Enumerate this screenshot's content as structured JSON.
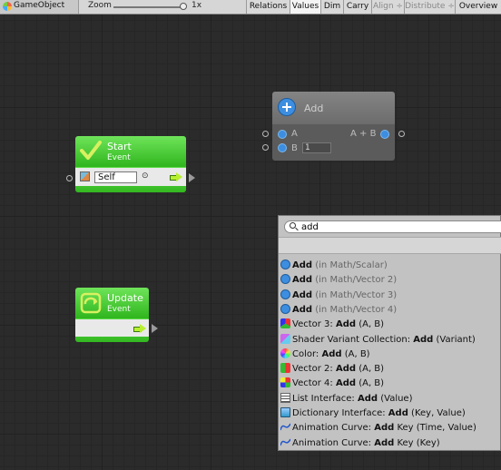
{
  "toolbar": {
    "breadcrumb": "GameObject",
    "zoom_label": "Zoom",
    "zoom_value": 1,
    "zoom_value_text": "1x",
    "buttons": [
      {
        "label": "Relations"
      },
      {
        "label": "Values"
      },
      {
        "label": "Dim"
      },
      {
        "label": "Carry"
      },
      {
        "label": "Align ÷"
      },
      {
        "label": "Distribute ÷"
      },
      {
        "label": "Overview"
      }
    ]
  },
  "nodes": {
    "start": {
      "title": "Start",
      "subtitle": "Event",
      "self_value": "Self",
      "port_symbol": "⊙"
    },
    "update": {
      "title": "Update",
      "subtitle": "Event"
    },
    "add": {
      "title": "Add",
      "input_a": "A",
      "input_b": "B",
      "input_b_value": "1",
      "output": "A + B"
    }
  },
  "search": {
    "query": "add",
    "results": [
      {
        "icon": "add-icon",
        "parts": [
          {
            "t": "Add",
            "s": "b"
          },
          {
            "t": " (in Math/Scalar)",
            "s": "d"
          }
        ]
      },
      {
        "icon": "add-icon",
        "parts": [
          {
            "t": "Add",
            "s": "b"
          },
          {
            "t": " (in Math/Vector 2)",
            "s": "d"
          }
        ]
      },
      {
        "icon": "add-icon",
        "parts": [
          {
            "t": "Add",
            "s": "b"
          },
          {
            "t": " (in Math/Vector 3)",
            "s": "d"
          }
        ]
      },
      {
        "icon": "add-icon",
        "parts": [
          {
            "t": "Add",
            "s": "b"
          },
          {
            "t": " (in Math/Vector 4)",
            "s": "d"
          }
        ]
      },
      {
        "icon": "vector3-icon",
        "parts": [
          {
            "t": "Vector 3: ",
            "s": ""
          },
          {
            "t": "Add",
            "s": "b"
          },
          {
            "t": " (A, B)",
            "s": ""
          }
        ]
      },
      {
        "icon": "shader-variant-icon",
        "parts": [
          {
            "t": "Shader Variant Collection: ",
            "s": ""
          },
          {
            "t": "Add",
            "s": "b"
          },
          {
            "t": " (Variant)",
            "s": ""
          }
        ]
      },
      {
        "icon": "color-icon",
        "parts": [
          {
            "t": "Color: ",
            "s": ""
          },
          {
            "t": "Add",
            "s": "b"
          },
          {
            "t": " (A, B)",
            "s": ""
          }
        ]
      },
      {
        "icon": "vector2-icon",
        "parts": [
          {
            "t": "Vector 2: ",
            "s": ""
          },
          {
            "t": "Add",
            "s": "b"
          },
          {
            "t": " (A, B)",
            "s": ""
          }
        ]
      },
      {
        "icon": "vector4-icon",
        "parts": [
          {
            "t": "Vector 4: ",
            "s": ""
          },
          {
            "t": "Add",
            "s": "b"
          },
          {
            "t": " (A, B)",
            "s": ""
          }
        ]
      },
      {
        "icon": "list-icon",
        "parts": [
          {
            "t": "List Interface: ",
            "s": ""
          },
          {
            "t": "Add",
            "s": "b"
          },
          {
            "t": " (Value)",
            "s": ""
          }
        ]
      },
      {
        "icon": "dictionary-icon",
        "parts": [
          {
            "t": "Dictionary Interface: ",
            "s": ""
          },
          {
            "t": "Add",
            "s": "b"
          },
          {
            "t": " (Key, Value)",
            "s": ""
          }
        ]
      },
      {
        "icon": "animation-curve-icon",
        "parts": [
          {
            "t": "Animation Curve: ",
            "s": ""
          },
          {
            "t": "Add",
            "s": "b"
          },
          {
            "t": " Key (Time, Value)",
            "s": ""
          }
        ]
      },
      {
        "icon": "animation-curve-icon",
        "parts": [
          {
            "t": "Animation Curve: ",
            "s": ""
          },
          {
            "t": "Add",
            "s": "b"
          },
          {
            "t": " Key (Key)",
            "s": ""
          }
        ]
      }
    ]
  },
  "colors": {
    "event_green": "#3fc52a",
    "graph_bg": "#2b2b2b",
    "add_node_bg": "#5e5e5e"
  }
}
